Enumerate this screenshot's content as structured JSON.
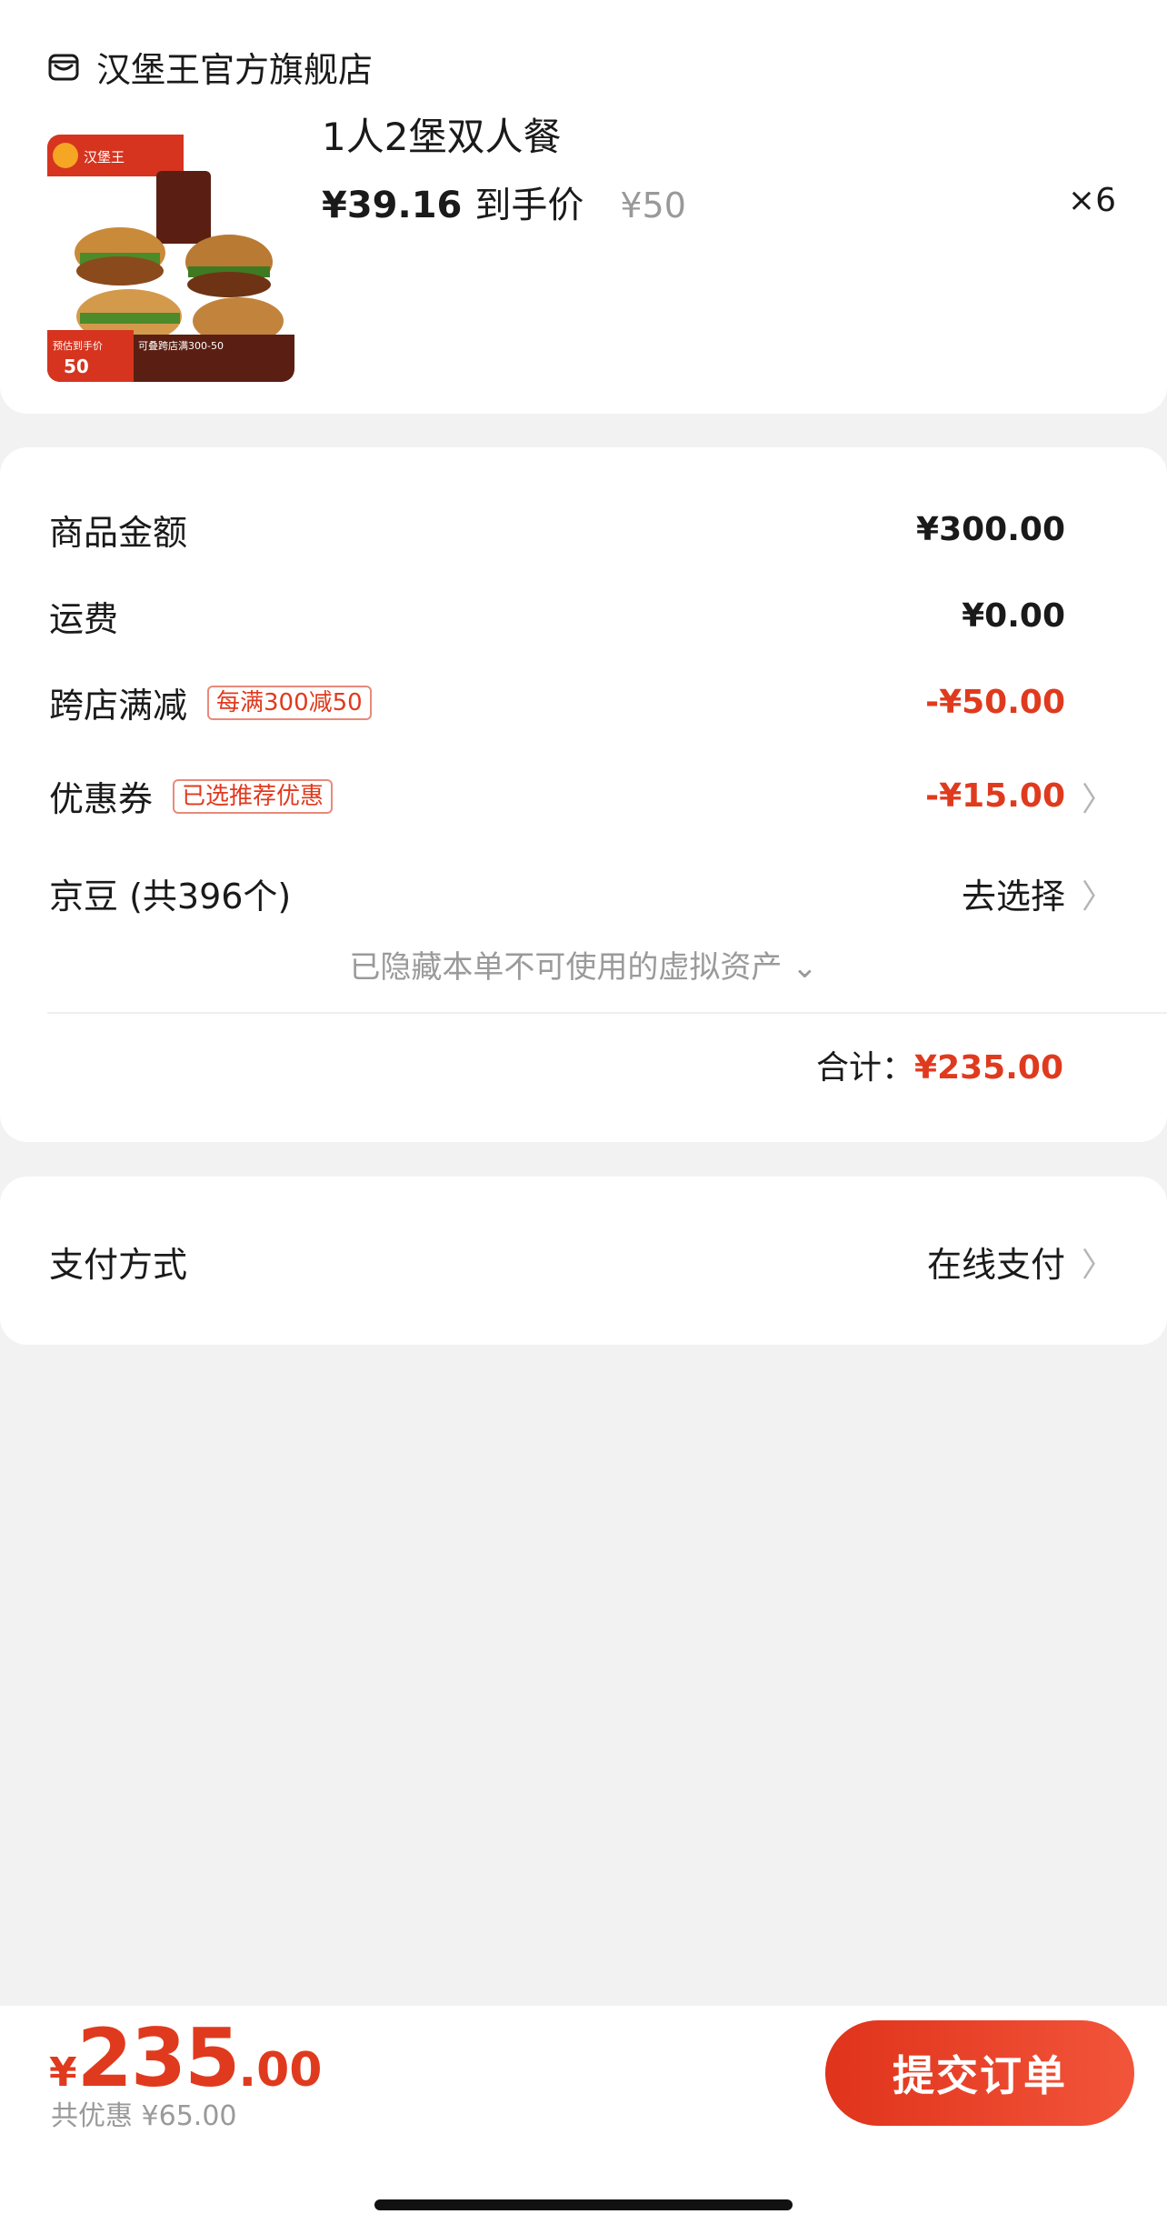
{
  "store": {
    "name": "汉堡王官方旗舰店",
    "icon": "store-icon"
  },
  "product": {
    "title": "1人2堡双人餐",
    "price": "¥39.16",
    "price_tag": "到手价",
    "original_price": "¥50",
    "quantity": "×6",
    "image_badge": "汉堡王",
    "image_promo": "可叠跨店满300-50",
    "image_price_label": "预估到手价",
    "image_price": "50"
  },
  "summary": {
    "goods_label": "商品金额",
    "goods_value": "¥300.00",
    "shipping_label": "运费",
    "shipping_value": "¥0.00",
    "cross_store_label": "跨店满减",
    "cross_store_tag": "每满300减50",
    "cross_store_value": "-¥50.00",
    "coupon_label": "优惠券",
    "coupon_tag": "已选推荐优惠",
    "coupon_value": "-¥15.00",
    "jingdou_label": "京豆 (共396个)",
    "jingdou_value": "去选择",
    "hidden_note": "已隐藏本单不可使用的虚拟资产",
    "total_label": "合计：",
    "total_value": "¥235.00"
  },
  "payment": {
    "label": "支付方式",
    "value": "在线支付"
  },
  "bottom": {
    "currency": "¥",
    "amount_int": "235",
    "amount_dec": ".00",
    "saved": "共优惠 ¥65.00",
    "submit": "提交订单"
  },
  "colors": {
    "accent": "#e03a1e",
    "background": "#f2f2f2"
  }
}
